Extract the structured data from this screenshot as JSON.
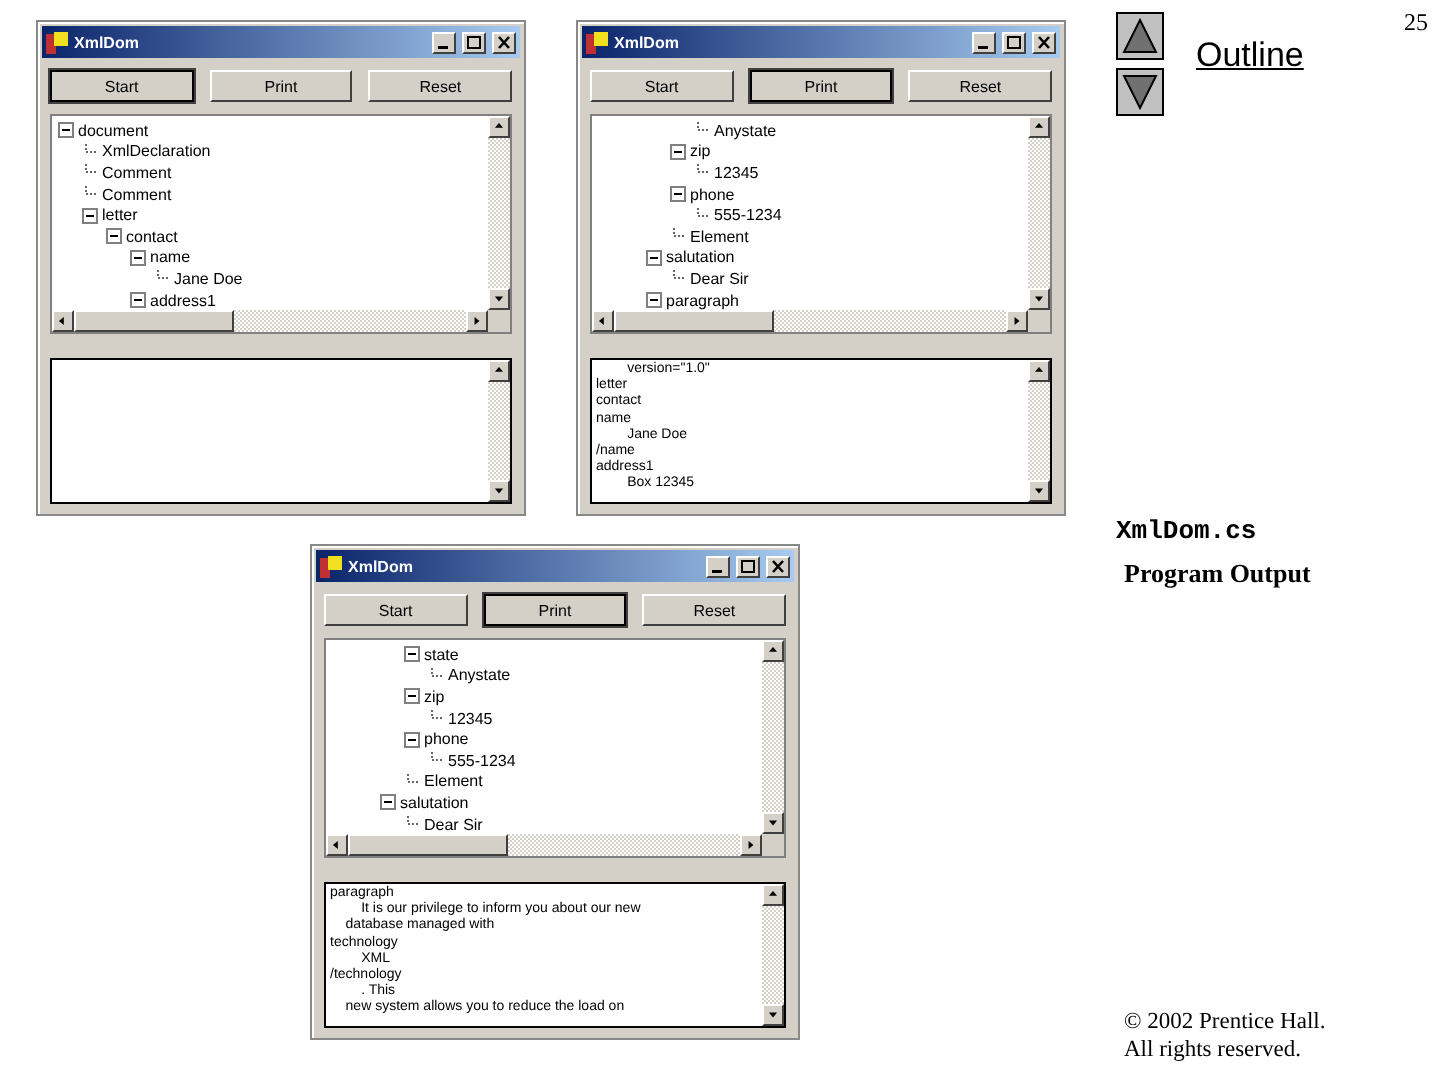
{
  "windows": [
    {
      "title": "XmlDom",
      "buttons": [
        {
          "label": "Start",
          "focused": true
        },
        {
          "label": "Print",
          "focused": false
        },
        {
          "label": "Reset",
          "focused": false
        }
      ],
      "tree": [
        {
          "label": "document",
          "expanded": true,
          "children": [
            {
              "label": "XmlDeclaration"
            },
            {
              "label": "Comment"
            },
            {
              "label": "Comment"
            },
            {
              "label": "letter",
              "expanded": true,
              "children": [
                {
                  "label": "contact",
                  "expanded": true,
                  "children": [
                    {
                      "label": "name",
                      "expanded": true,
                      "children": [
                        {
                          "label": "Jane Doe"
                        }
                      ]
                    },
                    {
                      "label": "address1",
                      "expanded": true
                    }
                  ]
                }
              ]
            }
          ]
        }
      ]
    },
    {
      "title": "XmlDom",
      "buttons": [
        {
          "label": "Start",
          "focused": false
        },
        {
          "label": "Print",
          "focused": true
        },
        {
          "label": "Reset",
          "focused": false
        }
      ],
      "tree": [
        {
          "children": [
            {
              "children": [
                {
                  "children": [
                    {
                      "children": [
                        {
                          "label": "Anystate"
                        }
                      ]
                    },
                    {
                      "label": "zip",
                      "expanded": true,
                      "children": [
                        {
                          "label": "12345"
                        }
                      ]
                    },
                    {
                      "label": "phone",
                      "expanded": true,
                      "children": [
                        {
                          "label": "555-1234"
                        }
                      ]
                    },
                    {
                      "label": "Element"
                    }
                  ]
                },
                {
                  "label": "salutation",
                  "expanded": true,
                  "children": [
                    {
                      "label": "Dear Sir"
                    }
                  ]
                },
                {
                  "label": "paragraph",
                  "expanded": true
                }
              ]
            }
          ]
        }
      ],
      "output": [
        "\t\tversion=\"1.0\"",
        "letter",
        "contact",
        "name",
        "\t\tJane Doe",
        "/name",
        "address1",
        "\t\tBox 12345"
      ]
    },
    {
      "title": "XmlDom",
      "buttons": [
        {
          "label": "Start",
          "focused": false
        },
        {
          "label": "Print",
          "focused": true
        },
        {
          "label": "Reset",
          "focused": false
        }
      ],
      "tree": [
        {
          "children": [
            {
              "children": [
                {
                  "children": [
                    {
                      "label": "state",
                      "expanded": true,
                      "children": [
                        {
                          "label": "Anystate"
                        }
                      ]
                    },
                    {
                      "label": "zip",
                      "expanded": true,
                      "children": [
                        {
                          "label": "12345"
                        }
                      ]
                    },
                    {
                      "label": "phone",
                      "expanded": true,
                      "children": [
                        {
                          "label": "555-1234"
                        }
                      ]
                    },
                    {
                      "label": "Element"
                    }
                  ]
                },
                {
                  "label": "salutation",
                  "expanded": true,
                  "children": [
                    {
                      "label": "Dear Sir"
                    }
                  ]
                }
              ]
            }
          ]
        }
      ],
      "output": [
        "paragraph",
        "\t\tIt is our privilege to inform you about our new",
        "\tdatabase managed with",
        "technology",
        "\t\tXML",
        "/technology",
        "\t\t. This",
        "\tnew system allows you to reduce the load on"
      ]
    }
  ],
  "slide": {
    "link": "Outline",
    "page_number": "25",
    "file_name": "XmlDom.cs",
    "caption": "Program Output",
    "copyright": "© 2002 Prentice Hall.",
    "rights": "All rights reserved."
  }
}
